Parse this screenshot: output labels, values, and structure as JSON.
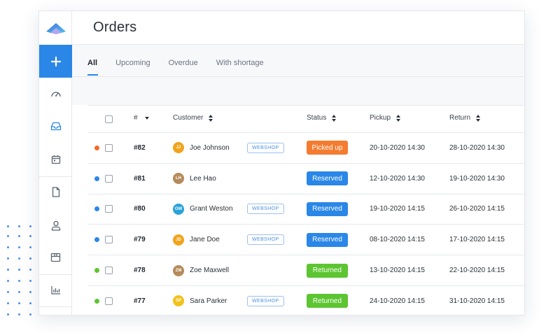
{
  "app": {
    "title": "Orders"
  },
  "tabs": [
    {
      "label": "All",
      "active": true
    },
    {
      "label": "Upcoming",
      "active": false
    },
    {
      "label": "Overdue",
      "active": false
    },
    {
      "label": "With shortage",
      "active": false
    }
  ],
  "sidebar": {
    "add_icon": "plus-icon",
    "items": [
      {
        "icon": "dashboard-icon"
      },
      {
        "icon": "inbox-icon",
        "active": true
      },
      {
        "icon": "calendar-icon"
      },
      {
        "icon": "document-icon"
      },
      {
        "icon": "user-icon"
      },
      {
        "icon": "box-icon"
      },
      {
        "icon": "bar-chart-icon"
      }
    ]
  },
  "table": {
    "columns": {
      "number": "#",
      "customer": "Customer",
      "status": "Status",
      "pickup": "Pickup",
      "return": "Return"
    },
    "rows": [
      {
        "dot": "#f26b2a",
        "number": "#82",
        "initials": "JJ",
        "avatar": "#f2a31b",
        "customer": "Joe Johnson",
        "badge": "WEBSHOP",
        "status": "Picked up",
        "status_color": "#f47c30",
        "pickup": "20-10-2020 14:30",
        "return": "28-10-2020 14:30"
      },
      {
        "dot": "#2a87e7",
        "number": "#81",
        "initials": "LH",
        "avatar": "#b58a5a",
        "customer": "Lee Hao",
        "badge": "",
        "status": "Reserved",
        "status_color": "#2a87e7",
        "pickup": "12-10-2020 14:30",
        "return": "19-10-2020 14:30"
      },
      {
        "dot": "#2a87e7",
        "number": "#80",
        "initials": "GW",
        "avatar": "#2aa3d8",
        "customer": "Grant Weston",
        "badge": "WEBSHOP",
        "status": "Reserved",
        "status_color": "#2a87e7",
        "pickup": "19-10-2020 14:15",
        "return": "26-10-2020 14:15"
      },
      {
        "dot": "#2a87e7",
        "number": "#79",
        "initials": "JD",
        "avatar": "#f2a31b",
        "customer": "Jane Doe",
        "badge": "WEBSHOP",
        "status": "Reserved",
        "status_color": "#2a87e7",
        "pickup": "08-10-2020 14:15",
        "return": "17-10-2020 14:15"
      },
      {
        "dot": "#5cc531",
        "number": "#78",
        "initials": "ZM",
        "avatar": "#b58a5a",
        "customer": "Zoe Maxwell",
        "badge": "",
        "status": "Returned",
        "status_color": "#5cc531",
        "pickup": "13-10-2020 14:15",
        "return": "22-10-2020 14:15"
      },
      {
        "dot": "#5cc531",
        "number": "#77",
        "initials": "SP",
        "avatar": "#f2c21b",
        "customer": "Sara Parker",
        "badge": "WEBSHOP",
        "status": "Returned",
        "status_color": "#5cc531",
        "pickup": "24-10-2020 14:15",
        "return": "31-10-2020 14:15"
      }
    ]
  }
}
